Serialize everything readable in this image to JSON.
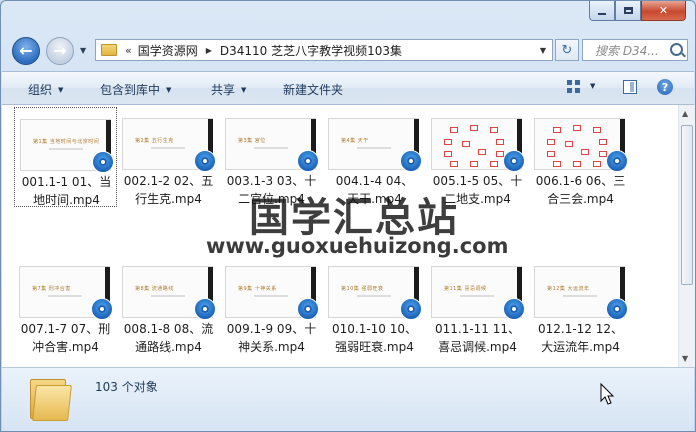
{
  "window": {
    "controls": {
      "minimize": "min",
      "maximize": "max",
      "close": "✕"
    }
  },
  "address": {
    "overflow": "«",
    "crumbs": [
      "国学资源网",
      "D34110 芝芝八字教学视频103集"
    ]
  },
  "search": {
    "placeholder": "搜索 D34..."
  },
  "toolbar": {
    "organize": "组织",
    "include_in_library": "包含到库中",
    "share": "共享",
    "new_folder": "新建文件夹",
    "help": "?"
  },
  "watermark": {
    "title": "国学汇总站",
    "url": "www.guoxuehuizong.com"
  },
  "files": [
    {
      "name": "001.1-1 01、当地时间.mp4",
      "line1": "001.1-1 01、当",
      "line2": "地时间.mp4",
      "thumb_text": "第1集 当地时间与北京时间",
      "selected": true
    },
    {
      "name": "002.1-2 02、五行生克.mp4",
      "line1": "002.1-2 02、五",
      "line2": "行生克.mp4",
      "thumb_text": "第2集 五行生克",
      "selected": false
    },
    {
      "name": "003.1-3 03、十二宫位.mp4",
      "line1": "003.1-3 03、十",
      "line2": "二宫位.mp4",
      "thumb_text": "第3集 宫位",
      "selected": false
    },
    {
      "name": "004.1-4 04、天干.mp4",
      "line1": "004.1-4 04、",
      "line2": "天干.mp4",
      "thumb_text": "第4集 天干",
      "selected": false
    },
    {
      "name": "005.1-5 05、十二地支.mp4",
      "line1": "005.1-5 05、十",
      "line2": "二地支.mp4",
      "thumb_text": "",
      "grid": true,
      "selected": false
    },
    {
      "name": "006.1-6 06、三合三会.mp4",
      "line1": "006.1-6 06、三",
      "line2": "合三会.mp4",
      "thumb_text": "",
      "grid": true,
      "selected": false
    },
    {
      "name": "007.1-7 07、刑冲合害.mp4",
      "line1": "007.1-7 07、刑",
      "line2": "冲合害.mp4",
      "thumb_text": "第7集 刑冲合害",
      "selected": false
    },
    {
      "name": "008.1-8 08、流通路线.mp4",
      "line1": "008.1-8 08、流",
      "line2": "通路线.mp4",
      "thumb_text": "第8集 流通路线",
      "selected": false
    },
    {
      "name": "009.1-9 09、十神关系.mp4",
      "line1": "009.1-9 09、十",
      "line2": "神关系.mp4",
      "thumb_text": "第9集 十神关系",
      "selected": false
    },
    {
      "name": "010.1-10 10、强弱旺衰.mp4",
      "line1": "010.1-10 10、",
      "line2": "强弱旺衰.mp4",
      "thumb_text": "第10集 强弱旺衰",
      "selected": false
    },
    {
      "name": "011.1-11 11、喜忌调候.mp4",
      "line1": "011.1-11 11、",
      "line2": "喜忌调候.mp4",
      "thumb_text": "第11集 喜忌调候",
      "selected": false
    },
    {
      "name": "012.1-12 12、大运流年.mp4",
      "line1": "012.1-12 12、",
      "line2": "大运流年.mp4",
      "thumb_text": "第12集 大运流年",
      "selected": false
    }
  ],
  "status": {
    "count": "103 个对象"
  }
}
